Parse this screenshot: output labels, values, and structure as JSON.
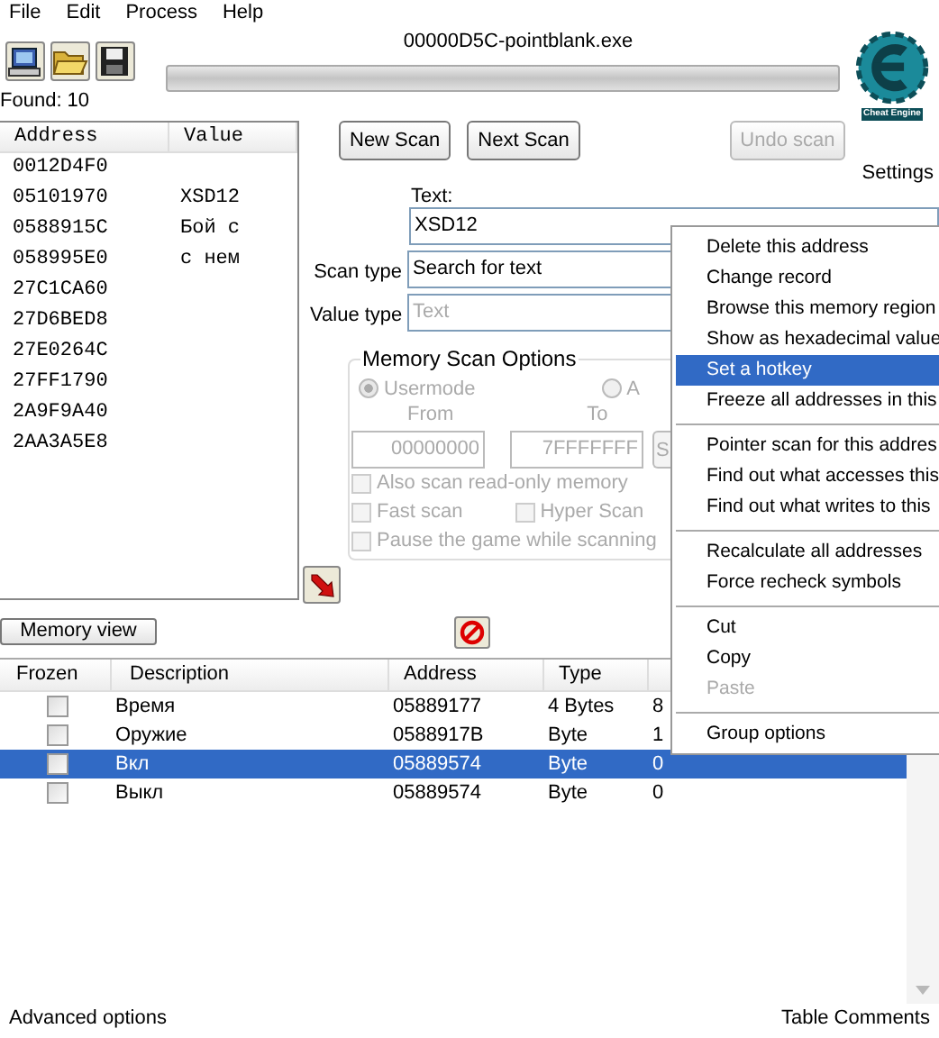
{
  "menu_bar": [
    "File",
    "Edit",
    "Process",
    "Help"
  ],
  "process_title": "00000D5C-pointblank.exe",
  "progress": {
    "level": 0
  },
  "logo_text": "Cheat Engine",
  "settings_label": "Settings",
  "found_label": "Found: 10",
  "results": {
    "columns": [
      "Address",
      "Value"
    ],
    "rows": [
      {
        "address": "0012D4F0"
      },
      {
        "address": "05101970",
        "value": "XSD12"
      },
      {
        "address": "0588915C",
        "value": "Бой с"
      },
      {
        "address": "058995E0",
        "value": "с нем"
      },
      {
        "address": "27C1CA60"
      },
      {
        "address": "27D6BED8"
      },
      {
        "address": "27E0264C"
      },
      {
        "address": "27FF1790"
      },
      {
        "address": "2A9F9A40"
      },
      {
        "address": "2AA3A5E8"
      }
    ]
  },
  "scan_buttons": [
    {
      "label": "New Scan",
      "disabled": false
    },
    {
      "label": "Next Scan",
      "disabled": false
    },
    {
      "label": "Undo scan",
      "disabled": true
    }
  ],
  "text_field": {
    "label": "Text:",
    "value": "XSD12"
  },
  "scan_type": {
    "label": "Scan type",
    "value": "Search for text",
    "disabled": false
  },
  "value_type": {
    "label": "Value type",
    "value": "Text",
    "disabled": true
  },
  "memory_scan_options": {
    "title": "Memory Scan Options",
    "disabled": true,
    "radios": [
      {
        "label": "Usermode",
        "selected": true
      },
      {
        "label": "A",
        "selected": false
      }
    ],
    "from_label": "From",
    "from_value": "00000000",
    "to_label": "To",
    "to_value": "7FFFFFFF",
    "button": "S",
    "checkboxes": [
      {
        "label": "Also scan read-only memory",
        "checked": false
      },
      {
        "label": "Fast scan",
        "checked": false
      },
      {
        "label": "Hyper Scan",
        "checked": false
      },
      {
        "label": "Pause the game while scanning",
        "checked": false
      }
    ]
  },
  "memory_view_button": "Memory view",
  "address_table": {
    "columns": [
      "Frozen",
      "Description",
      "Address",
      "Type"
    ],
    "rows": [
      {
        "frozen": false,
        "description": "Время",
        "address": "05889177",
        "type": "4 Bytes",
        "value": "8",
        "selected": false
      },
      {
        "frozen": false,
        "description": "Оружие",
        "address": "0588917B",
        "type": "Byte",
        "value": "1",
        "selected": false
      },
      {
        "frozen": false,
        "description": "Вкл",
        "address": "05889574",
        "type": "Byte",
        "value": "0",
        "selected": true
      },
      {
        "frozen": false,
        "description": "Выкл",
        "address": "05889574",
        "type": "Byte",
        "value": "0",
        "selected": false
      }
    ]
  },
  "context_menu": {
    "groups": [
      [
        {
          "label": "Delete this address",
          "selected": false,
          "disabled": false
        },
        {
          "label": "Change record",
          "selected": false,
          "disabled": false
        },
        {
          "label": "Browse this memory region",
          "selected": false,
          "disabled": false
        },
        {
          "label": "Show as hexadecimal value",
          "selected": false,
          "disabled": false
        },
        {
          "label": "Set a hotkey",
          "selected": true,
          "disabled": false
        },
        {
          "label": "Freeze all addresses in this",
          "selected": false,
          "disabled": false
        }
      ],
      [
        {
          "label": "Pointer scan for this addres",
          "selected": false,
          "disabled": false
        },
        {
          "label": "Find out what accesses this",
          "selected": false,
          "disabled": false
        },
        {
          "label": "Find out what writes to this",
          "selected": false,
          "disabled": false
        }
      ],
      [
        {
          "label": "Recalculate all addresses",
          "selected": false,
          "disabled": false
        },
        {
          "label": "Force recheck symbols",
          "selected": false,
          "disabled": false
        }
      ],
      [
        {
          "label": "Cut",
          "selected": false,
          "disabled": false
        },
        {
          "label": "Copy",
          "selected": false,
          "disabled": false
        },
        {
          "label": "Paste",
          "selected": false,
          "disabled": true
        }
      ],
      [
        {
          "label": "Group options",
          "selected": false,
          "disabled": false
        }
      ]
    ]
  },
  "footer": {
    "left": "Advanced options",
    "right": "Table Comments"
  }
}
